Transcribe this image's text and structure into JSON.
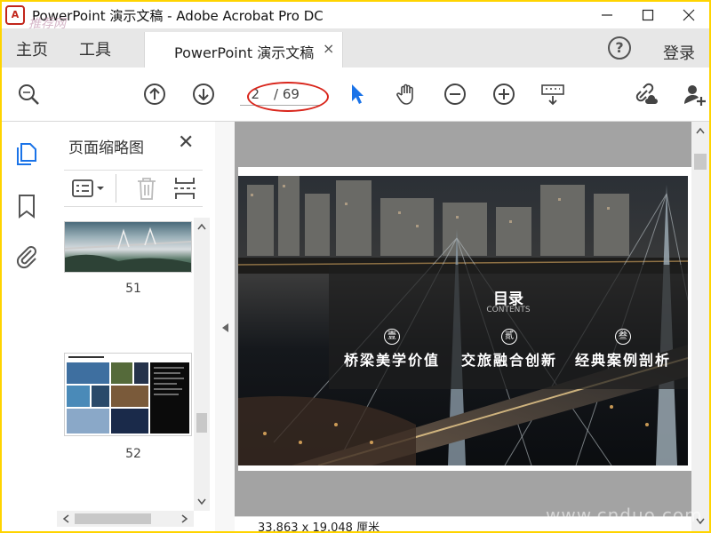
{
  "window": {
    "title": "PowerPoint 演示文稿 - Adobe Acrobat Pro DC",
    "logo_text": "A",
    "watermark_top": "推荐网",
    "watermark_bottom": "www.cnduo.com"
  },
  "tabs": {
    "home": "主页",
    "tools": "工具",
    "document": "PowerPoint 演示文稿",
    "close": "×",
    "help": "?",
    "login": "登录"
  },
  "toolbar": {
    "current_page": "2",
    "page_total": "/ 69",
    "icons": [
      "search-icon",
      "page-up-icon",
      "page-down-icon",
      "select-cursor-icon",
      "hand-icon",
      "zoom-out-icon",
      "zoom-in-icon",
      "keyboard-icon",
      "share-link-icon",
      "add-user-icon"
    ]
  },
  "sidebar": {
    "icons": [
      "page-thumbnails-icon",
      "bookmark-icon",
      "attachment-icon"
    ]
  },
  "thumbnails_panel": {
    "title": "页面缩略图",
    "close": "✕",
    "items": [
      {
        "page": "51"
      },
      {
        "page": "52"
      }
    ]
  },
  "slide": {
    "title": "目录",
    "subtitle": "CONTENTS",
    "items": [
      {
        "badge": "壹",
        "label": "桥梁美学价值"
      },
      {
        "badge": "贰",
        "label": "交旅融合创新"
      },
      {
        "badge": "叁",
        "label": "经典案例剖析"
      }
    ]
  },
  "status": {
    "page_size": "33.863 x 19.048 厘米"
  },
  "colors": {
    "accent_blue": "#1a73e8",
    "annotation_red": "#d9261c",
    "frame_yellow": "#ffd400"
  }
}
